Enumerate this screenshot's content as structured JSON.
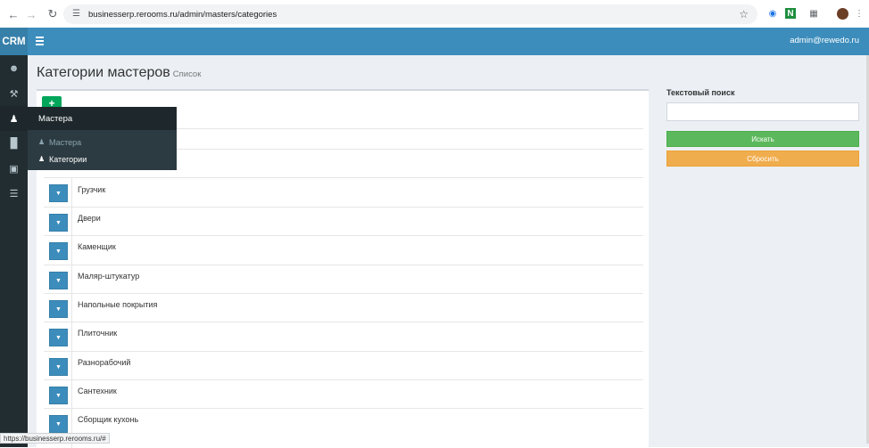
{
  "browser": {
    "url": "businesserp.rerooms.ru/admin/masters/categories",
    "status_url": "https://businesserp.rerooms.ru/#"
  },
  "app": {
    "brand": "CRM",
    "user": "admin@rewedo.ru"
  },
  "sidebar": {
    "flyout_title": "Мастера",
    "flyout_items": [
      "Мастера",
      "Категории"
    ]
  },
  "page": {
    "title": "Категории мастеров",
    "subtitle": "Список"
  },
  "table": {
    "add_label": "+",
    "rows": [
      "Грузчик",
      "Двери",
      "Каменщик",
      "Маляр-штукатур",
      "Напольные покрытия",
      "Плиточник",
      "Разнорабочий",
      "Сантехник",
      "Сборщик кухонь"
    ]
  },
  "search": {
    "title": "Текстовый поиск",
    "submit": "Искать",
    "reset": "Сбросить"
  },
  "colors": {
    "header": "#3c8dbc",
    "sidebar": "#222d32",
    "success": "#5cb85c",
    "warning": "#f0ad4e"
  }
}
